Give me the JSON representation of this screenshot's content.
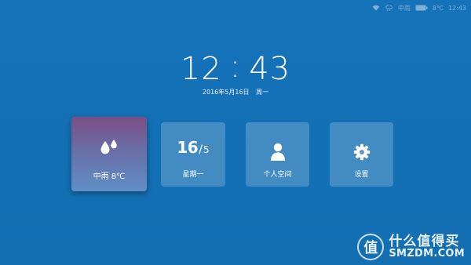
{
  "status_bar": {
    "weather": "中雨",
    "temperature": "8℃",
    "time": "12:43",
    "icons": [
      "wifi-icon",
      "cloud-rain-icon",
      "battery-icon"
    ]
  },
  "clock": {
    "hours": "12",
    "separator": ":",
    "minutes": "43",
    "date": "2016年5月16日",
    "weekday": "周一"
  },
  "tiles": {
    "weather": {
      "icon": "raindrops-icon",
      "label": "中雨 8℃"
    },
    "calendar": {
      "day": "16",
      "separator": "/",
      "month": "5",
      "label": "星期一"
    },
    "space": {
      "icon": "person-icon",
      "label": "个人空间"
    },
    "settings": {
      "icon": "gear-icon",
      "label": "设置"
    }
  },
  "watermark": {
    "logo_char": "值",
    "title": "什么值得买",
    "site": "SMZDM.COM"
  },
  "colors": {
    "background": "#1470b5",
    "tile": "#4d8cc7",
    "weather_tile_top": "#7a4f86",
    "weather_tile_bottom": "#5f8fc6"
  }
}
